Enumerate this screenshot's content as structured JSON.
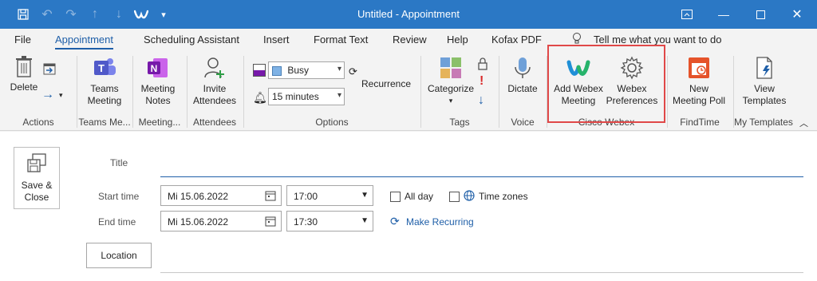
{
  "window": {
    "title": "Untitled  -  Appointment",
    "controls": [
      "restore-ribbon",
      "minimize",
      "maximize",
      "close"
    ]
  },
  "ribbon_tabs": [
    {
      "label": "File"
    },
    {
      "label": "Appointment",
      "active": true
    },
    {
      "label": "Scheduling Assistant"
    },
    {
      "label": "Insert"
    },
    {
      "label": "Format Text"
    },
    {
      "label": "Review"
    },
    {
      "label": "Help"
    },
    {
      "label": "Kofax PDF"
    }
  ],
  "tell_me": "Tell me what you want to do",
  "groups": {
    "actions": {
      "label": "Actions",
      "delete": "Delete"
    },
    "teams": {
      "label": "Teams Me...",
      "button": "Teams\nMeeting"
    },
    "meeting_notes": {
      "label": "Meeting...",
      "button": "Meeting\nNotes"
    },
    "attendees": {
      "label": "Attendees",
      "button": "Invite\nAttendees"
    },
    "options": {
      "label": "Options",
      "show_as": "Busy",
      "reminder": "15 minutes",
      "recurrence": "Recurrence"
    },
    "tags": {
      "label": "Tags",
      "categorize": "Categorize"
    },
    "voice": {
      "label": "Voice",
      "dictate": "Dictate"
    },
    "webex": {
      "label": "Cisco Webex",
      "add": "Add Webex\nMeeting",
      "prefs": "Webex\nPreferences"
    },
    "findtime": {
      "label": "FindTime",
      "button": "New\nMeeting Poll"
    },
    "templates": {
      "label": "My Templates",
      "button": "View\nTemplates"
    }
  },
  "form": {
    "save_close": "Save &\nClose",
    "title_label": "Title",
    "title_value": "",
    "start_label": "Start time",
    "start_date": "Mi 15.06.2022",
    "start_time": "17:00",
    "end_label": "End time",
    "end_date": "Mi 15.06.2022",
    "end_time": "17:30",
    "all_day": "All day",
    "time_zones": "Time zones",
    "make_recurring": "Make Recurring",
    "location": "Location"
  },
  "colors": {
    "titlebar": "#2b78c5",
    "accent": "#1f5fa8",
    "highlight_box": "#e04848",
    "findtime_orange": "#e5532a",
    "onenote_purple": "#7719aa",
    "teams_purple": "#5059c9"
  }
}
